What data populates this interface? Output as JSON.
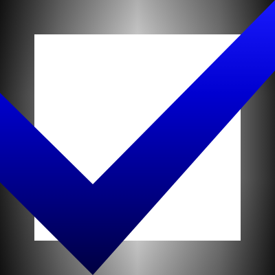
{
  "checkbox": {
    "checked": true,
    "check_color": "#0000c8",
    "frame_color": "#808080",
    "box_color": "#ffffff"
  }
}
